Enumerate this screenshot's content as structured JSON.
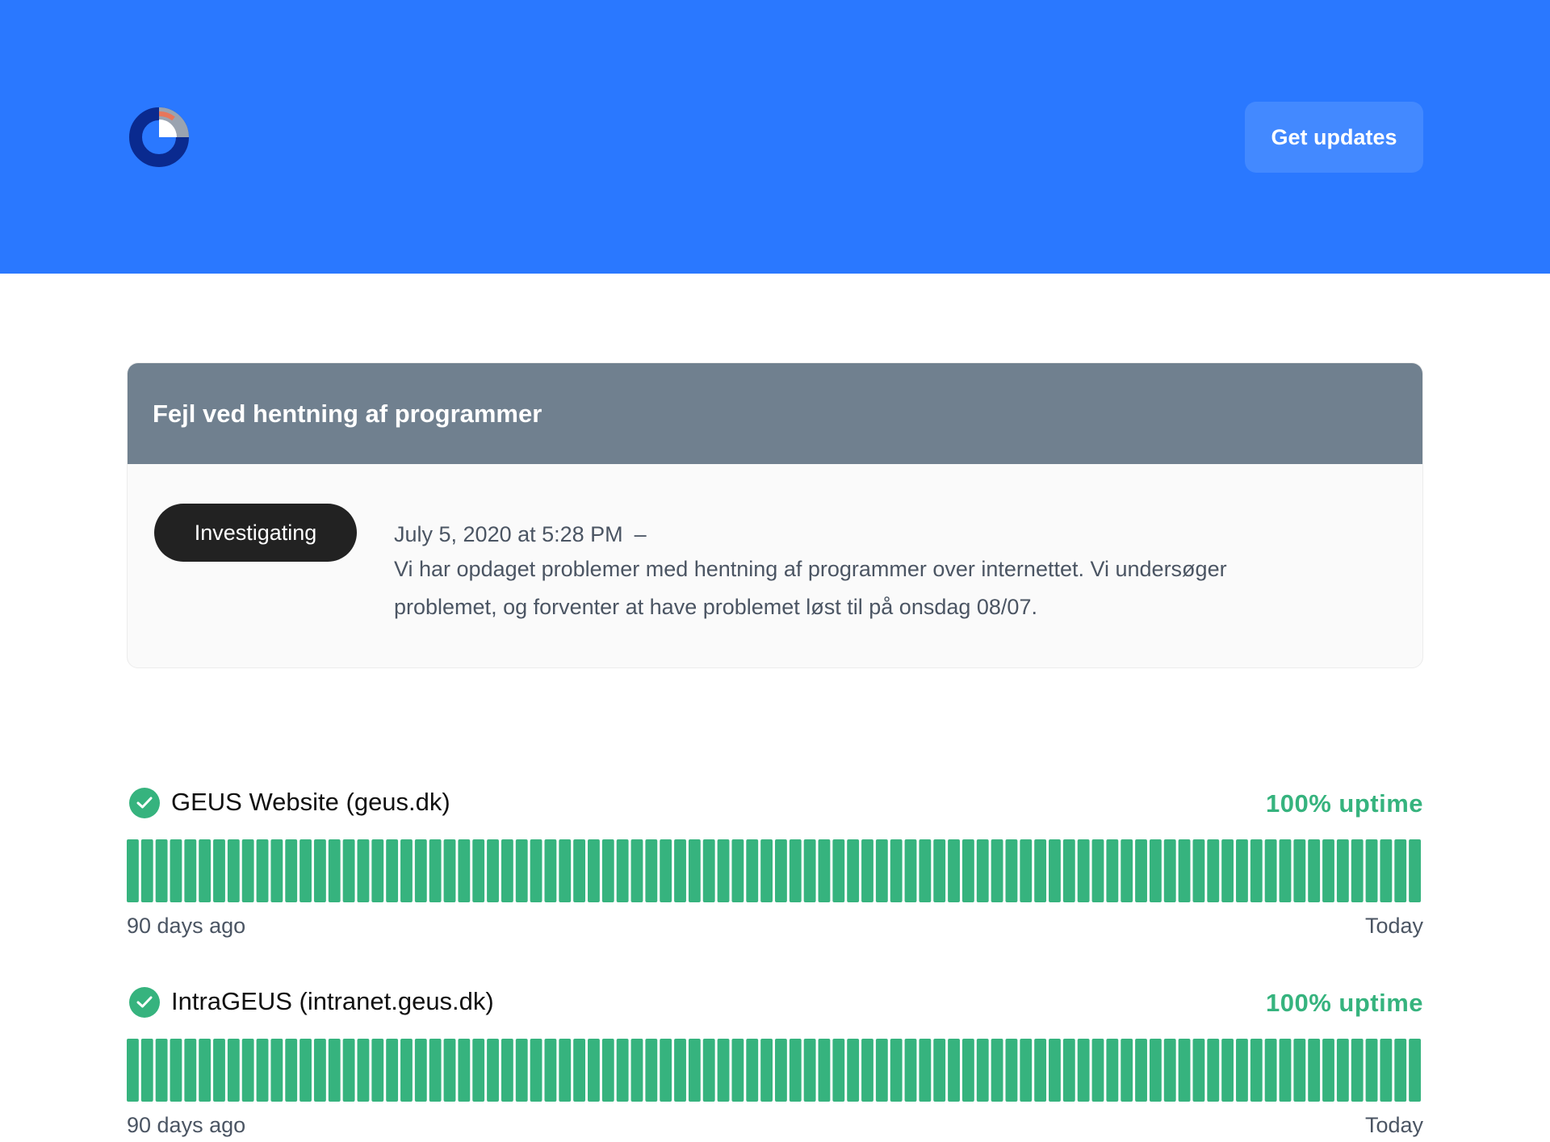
{
  "header": {
    "button_label": "Get updates",
    "brand_color": "#2a78ff",
    "logo_icon": "status-page-logo"
  },
  "incident": {
    "title": "Fejl ved hentning af programmer",
    "status": "Investigating",
    "timestamp": "July 5, 2020 at 5:28 PM",
    "separator": "–",
    "message": "Vi har opdaget problemer med hentning af programmer over internettet. Vi undersøger problemet, og forventer at have problemet løst til på onsdag 08/07."
  },
  "components": [
    {
      "name": "GEUS Website (geus.dk)",
      "uptime": "100% uptime",
      "status_icon": "check-circle-icon",
      "days": 90,
      "start_label": "90 days ago",
      "end_label": "Today",
      "bar_color": "#36b37e"
    },
    {
      "name": "IntraGEUS (intranet.geus.dk)",
      "uptime": "100% uptime",
      "status_icon": "check-circle-icon",
      "days": 90,
      "start_label": "90 days ago",
      "end_label": "Today",
      "bar_color": "#36b37e"
    }
  ]
}
